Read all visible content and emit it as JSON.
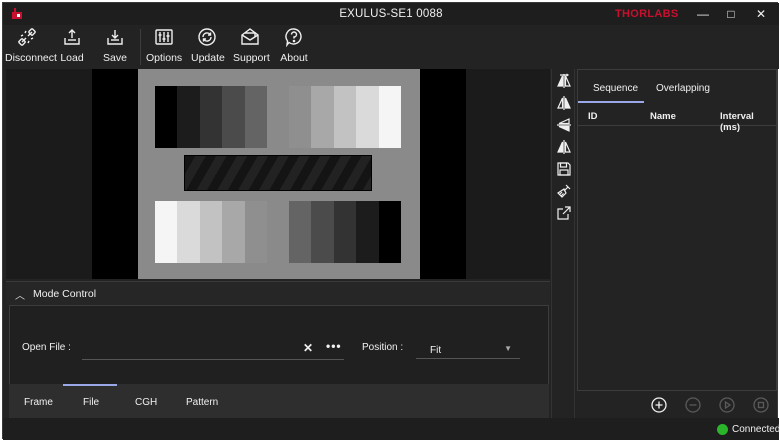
{
  "window": {
    "title": "EXULUS-SE1 0088",
    "brand": "THORLABS",
    "minimize_glyph": "—",
    "maximize_glyph": "□",
    "close_glyph": "✕"
  },
  "toolbar": {
    "disconnect": "Disconnect",
    "load": "Load",
    "save": "Save",
    "options": "Options",
    "update": "Update",
    "support": "Support",
    "about": "About"
  },
  "mode_control": {
    "title": "Mode Control",
    "open_file_label": "Open File :",
    "open_file_value": "",
    "clear_glyph": "✕",
    "browse_glyph": "•••",
    "position_label": "Position :",
    "position_value": "Fit"
  },
  "mode_tabs": {
    "frame": "Frame",
    "file": "File",
    "cgh": "CGH",
    "pattern": "Pattern",
    "selected": "File"
  },
  "sequence_panel": {
    "tab_sequence": "Sequence",
    "tab_overlapping": "Overlapping",
    "selected_tab": "Sequence",
    "columns": [
      "ID",
      "Name",
      "Interval (ms)"
    ],
    "rows": []
  },
  "preview": {
    "top_left_levels": [
      "#000000",
      "#1c1c1c",
      "#333333",
      "#4b4b4b",
      "#646464"
    ],
    "top_right_levels": [
      "#8f8f8f",
      "#a8a8a8",
      "#c2c2c2",
      "#dadada",
      "#f5f5f5"
    ],
    "bottom_left_levels": [
      "#f5f5f5",
      "#dadada",
      "#c2c2c2",
      "#a8a8a8",
      "#8f8f8f"
    ],
    "bottom_right_levels": [
      "#646464",
      "#4b4b4b",
      "#333333",
      "#1c1c1c",
      "#000000"
    ]
  },
  "status": {
    "connection": "Connected",
    "connection_color": "#2bb52b"
  },
  "colors": {
    "accent": "#9aa7e8",
    "brand_red": "#c8102e"
  }
}
